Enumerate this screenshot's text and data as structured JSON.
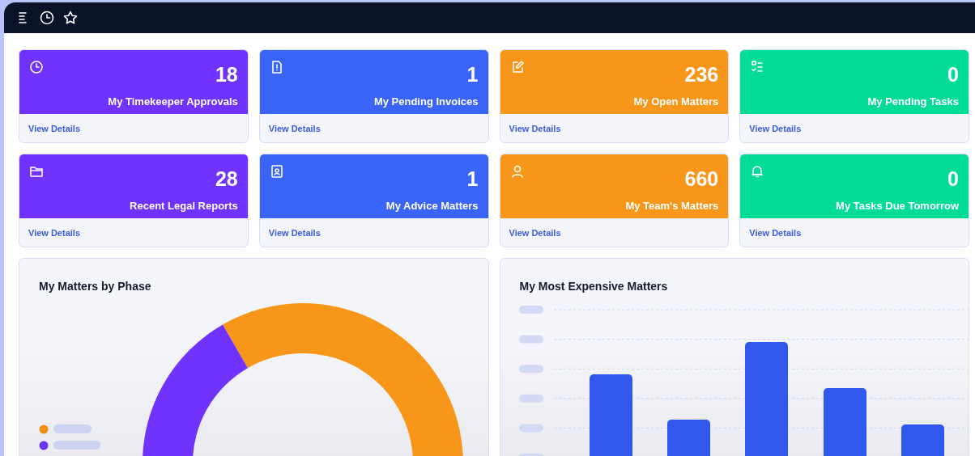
{
  "cards": [
    {
      "count": "18",
      "label": "My Timekeeper Approvals",
      "link": "View Details",
      "color": "#7033fd"
    },
    {
      "count": "1",
      "label": "My Pending Invoices",
      "link": "View Details",
      "color": "#3a63f8"
    },
    {
      "count": "236",
      "label": "My Open Matters",
      "link": "View Details",
      "color": "#f89619"
    },
    {
      "count": "0",
      "label": "My Pending Tasks",
      "link": "View Details",
      "color": "#03dc97"
    },
    {
      "count": "28",
      "label": "Recent Legal Reports",
      "link": "View Details",
      "color": "#7033fd"
    },
    {
      "count": "1",
      "label": "My Advice Matters",
      "link": "View Details",
      "color": "#3a63f8"
    },
    {
      "count": "660",
      "label": "My Team's Matters",
      "link": "View Details",
      "color": "#f89619"
    },
    {
      "count": "0",
      "label": "My Tasks Due Tomorrow",
      "link": "View Details",
      "color": "#03dc97"
    }
  ],
  "panels": [
    {
      "title": "My Matters by Phase",
      "kind": "donut"
    },
    {
      "title": "My Most Expensive Matters",
      "kind": "bar"
    }
  ]
}
